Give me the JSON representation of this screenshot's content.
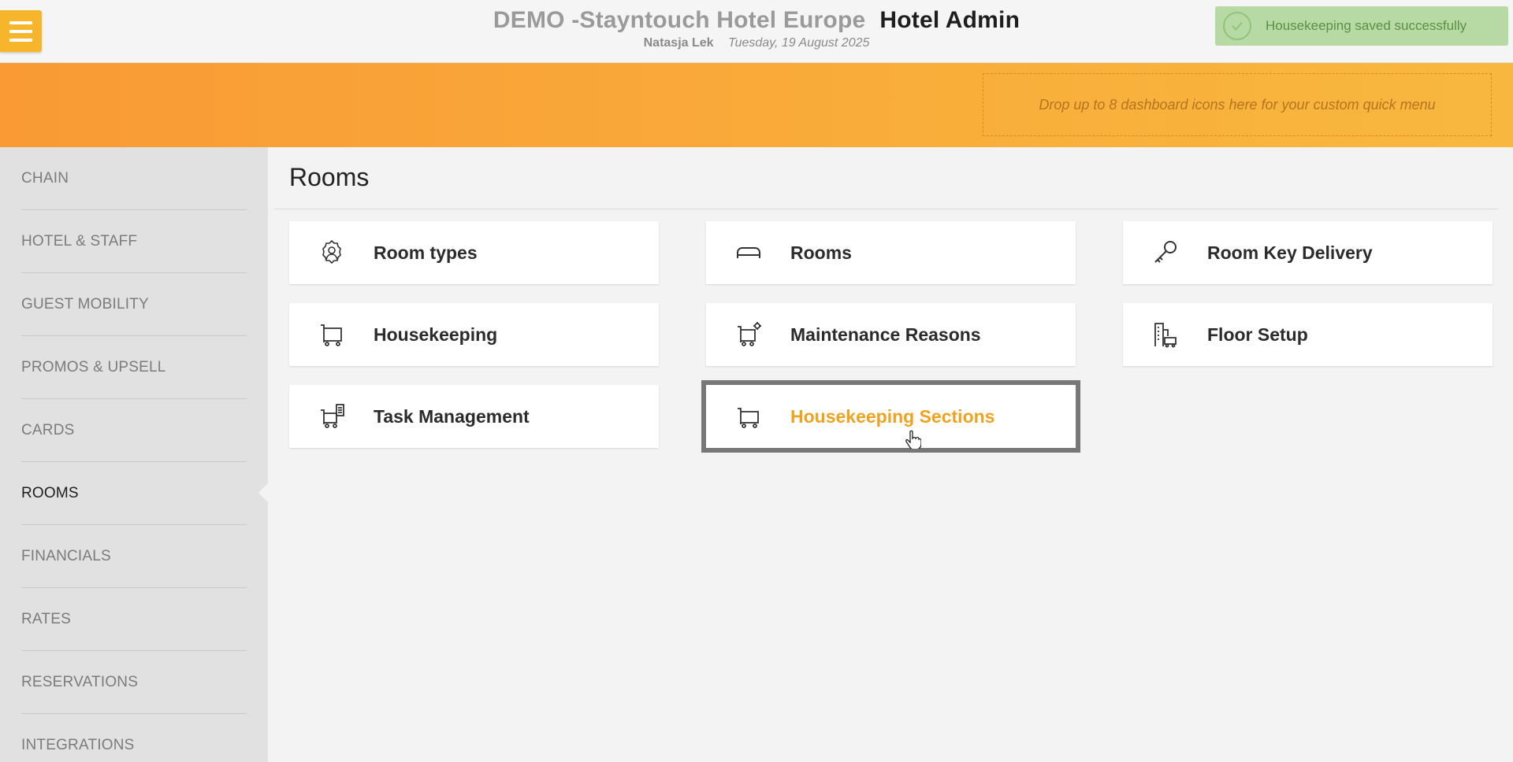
{
  "header": {
    "hotel_name": "DEMO -Stayntouch Hotel Europe",
    "app_name": "Hotel Admin",
    "user_name": "Natasja Lek",
    "date": "Tuesday, 19 August 2025",
    "menu_icon": "hamburger-icon"
  },
  "toast": {
    "message": "Housekeeping saved successfully",
    "icon": "check-circle-icon",
    "color": "#b7d9a4"
  },
  "banner": {
    "dropzone_text": "Drop up to 8 dashboard icons here for your custom quick menu"
  },
  "sidebar": {
    "items": [
      {
        "label": "CHAIN",
        "active": false
      },
      {
        "label": "HOTEL & STAFF",
        "active": false
      },
      {
        "label": "GUEST MOBILITY",
        "active": false
      },
      {
        "label": "PROMOS & UPSELL",
        "active": false
      },
      {
        "label": "CARDS",
        "active": false
      },
      {
        "label": "ROOMS",
        "active": true
      },
      {
        "label": "FINANCIALS",
        "active": false
      },
      {
        "label": "RATES",
        "active": false
      },
      {
        "label": "RESERVATIONS",
        "active": false
      },
      {
        "label": "INTEGRATIONS",
        "active": false
      }
    ]
  },
  "main": {
    "title": "Rooms",
    "cards": [
      {
        "label": "Room types",
        "icon": "gear-person-icon"
      },
      {
        "label": "Rooms",
        "icon": "bed-icon"
      },
      {
        "label": "Room Key Delivery",
        "icon": "key-icon"
      },
      {
        "label": "Housekeeping",
        "icon": "cart-icon"
      },
      {
        "label": "Maintenance Reasons",
        "icon": "cart-gear-icon"
      },
      {
        "label": "Floor Setup",
        "icon": "building-cart-icon"
      },
      {
        "label": "Task Management",
        "icon": "cart-clipboard-icon"
      },
      {
        "label": "Housekeeping Sections",
        "icon": "cart-icon",
        "selected": true
      }
    ]
  },
  "colors": {
    "accent": "#f7b52b",
    "banner_start": "#f99a35",
    "banner_end": "#f8b83f",
    "selected_label": "#f0a21f"
  }
}
